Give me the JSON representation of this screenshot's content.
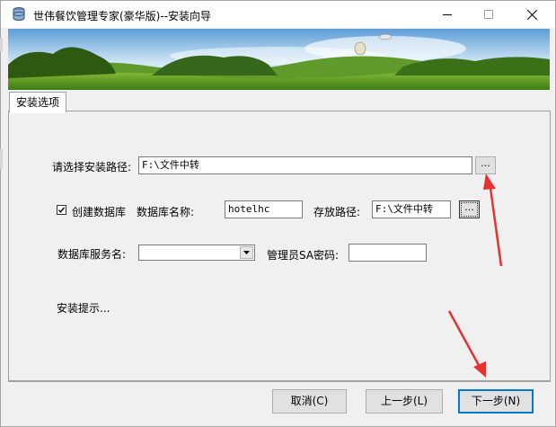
{
  "window": {
    "title": "世伟餐饮管理专家(豪华版)--安装向导"
  },
  "tabs": [
    {
      "label": "安装选项"
    }
  ],
  "form": {
    "install_path_label": "请选择安装路径:",
    "install_path_value": "F:\\文件中转",
    "browse_label": "...",
    "create_db_label": "创建数据库",
    "create_db_checked": true,
    "db_name_label": "数据库名称:",
    "db_name_value": "hotelhc",
    "store_path_label": "存放路径:",
    "store_path_value": "F:\\文件中转",
    "db_server_label": "数据库服务名:",
    "db_server_value": "",
    "sa_password_label": "管理员SA密码:",
    "sa_password_value": "",
    "hint_text": "安装提示..."
  },
  "buttons": {
    "cancel": "取消(C)",
    "prev": "上一步(L)",
    "next": "下一步(N)"
  },
  "colors": {
    "annotation_arrow": "#e8312f",
    "default_button_border": "#0078d7"
  }
}
